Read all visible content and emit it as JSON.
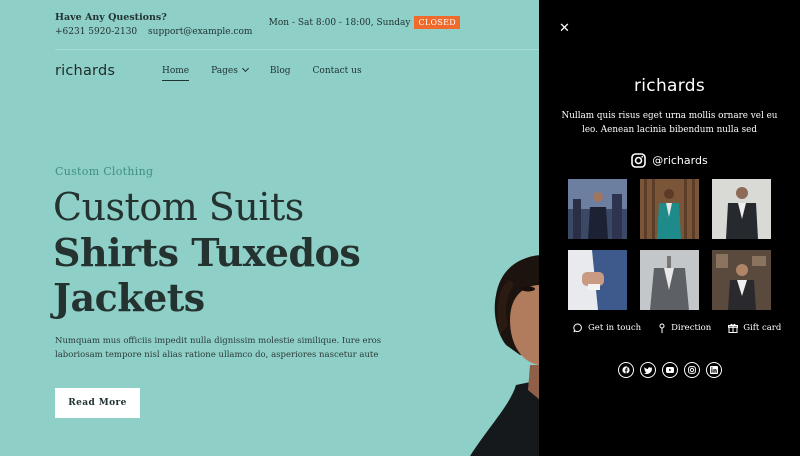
{
  "topbar": {
    "question_title": "Have Any Questions?",
    "phone": "+6231 5920-2130",
    "email": "support@example.com",
    "hours": "Mon - Sat 8:00 - 18:00,  Sunday",
    "closed_badge": "CLOSED"
  },
  "header": {
    "logo": "richards",
    "nav": [
      {
        "label": "Home",
        "active": true
      },
      {
        "label": "Pages",
        "dropdown": true
      },
      {
        "label": "Blog"
      },
      {
        "label": "Contact us"
      }
    ]
  },
  "hero": {
    "eyebrow": "Custom Clothing",
    "line1": "Custom Suits",
    "line2": "Shirts Tuxedos",
    "line3": "Jackets",
    "body": "Numquam mus officiis impedit nulla dignissim molestie similique. Iure eros laboriosam tempore nisl alias ratione ullamco do, asperiores nascetur aute",
    "button": "Read More"
  },
  "panel": {
    "close_icon": "close-icon",
    "logo": "richards",
    "description": "Nullam quis risus eget urna mollis ornare vel eu leo. Aenean lacinia bibendum nulla sed",
    "instagram_handle": "@richards",
    "links": [
      {
        "label": "Get in touch",
        "icon": "chat-bubble-icon"
      },
      {
        "label": "Direction",
        "icon": "map-pin-icon"
      },
      {
        "label": "Gift card",
        "icon": "gift-icon"
      }
    ],
    "socials": [
      "facebook-icon",
      "twitter-icon",
      "youtube-icon",
      "instagram-icon",
      "linkedin-icon"
    ]
  },
  "colors": {
    "background": "#8ecfc7",
    "accent": "#3f8f83",
    "badge": "#f06a2c",
    "panel": "#000000"
  }
}
